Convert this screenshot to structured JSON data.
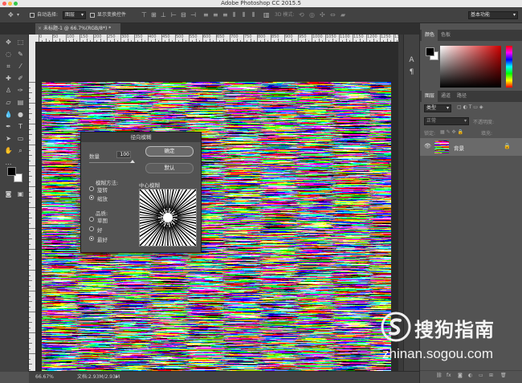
{
  "app": {
    "title": "Adobe Photoshop CC 2015.5",
    "workspace": "基本功能"
  },
  "options_bar": {
    "auto_select_label": "自动选择:",
    "auto_select_value": "图层",
    "show_transform_label": "显示变换控件",
    "mode_3d_label": "3D 模式:"
  },
  "document": {
    "tab_title": "未标题-1 @ 66.7%(RGB/8*) *"
  },
  "ruler": {
    "top_labels": [
      "0",
      "50",
      "100",
      "150",
      "200",
      "250",
      "300",
      "350",
      "400",
      "450",
      "500",
      "550",
      "600",
      "650",
      "700",
      "750",
      "800",
      "850",
      "900",
      "950",
      "1000",
      "1050",
      "1100",
      "1150",
      "1200",
      "1250",
      "1300"
    ],
    "left_labels": [
      "0",
      "5",
      "10",
      "15",
      "20",
      "25",
      "30",
      "35",
      "40",
      "45",
      "50",
      "55",
      "60",
      "65",
      "70"
    ]
  },
  "status_bar": {
    "zoom": "66.67%",
    "doc_info": "文档:2.93M/2.93M"
  },
  "dialog": {
    "title": "径向模糊",
    "amount_label": "数量",
    "amount_value": "100",
    "ok_label": "确定",
    "cancel_label": "默认",
    "method_label": "模糊方法:",
    "method_spin": "旋转",
    "method_zoom": "缩放",
    "method_selected": "缩放",
    "quality_label": "品质:",
    "quality_draft": "草图",
    "quality_good": "好",
    "quality_best": "最好",
    "quality_selected": "最好",
    "center_label": "中心模糊"
  },
  "panels": {
    "color_tab": "颜色",
    "swatches_tab": "色板",
    "layers_tab": "图层",
    "channels_tab": "通道",
    "paths_tab": "路径",
    "kind_filter": "类型",
    "blend_mode": "正常",
    "opacity_label": "不透明度:",
    "lock_label": "锁定:",
    "fill_label": "填充:",
    "layer_name": "背景"
  },
  "watermark": {
    "cn": "搜狗指南",
    "url": "zhinan.sogou.com"
  },
  "colors": {
    "panel": "#535353",
    "dark": "#2b2b2b",
    "accent_red": "#d00000"
  }
}
